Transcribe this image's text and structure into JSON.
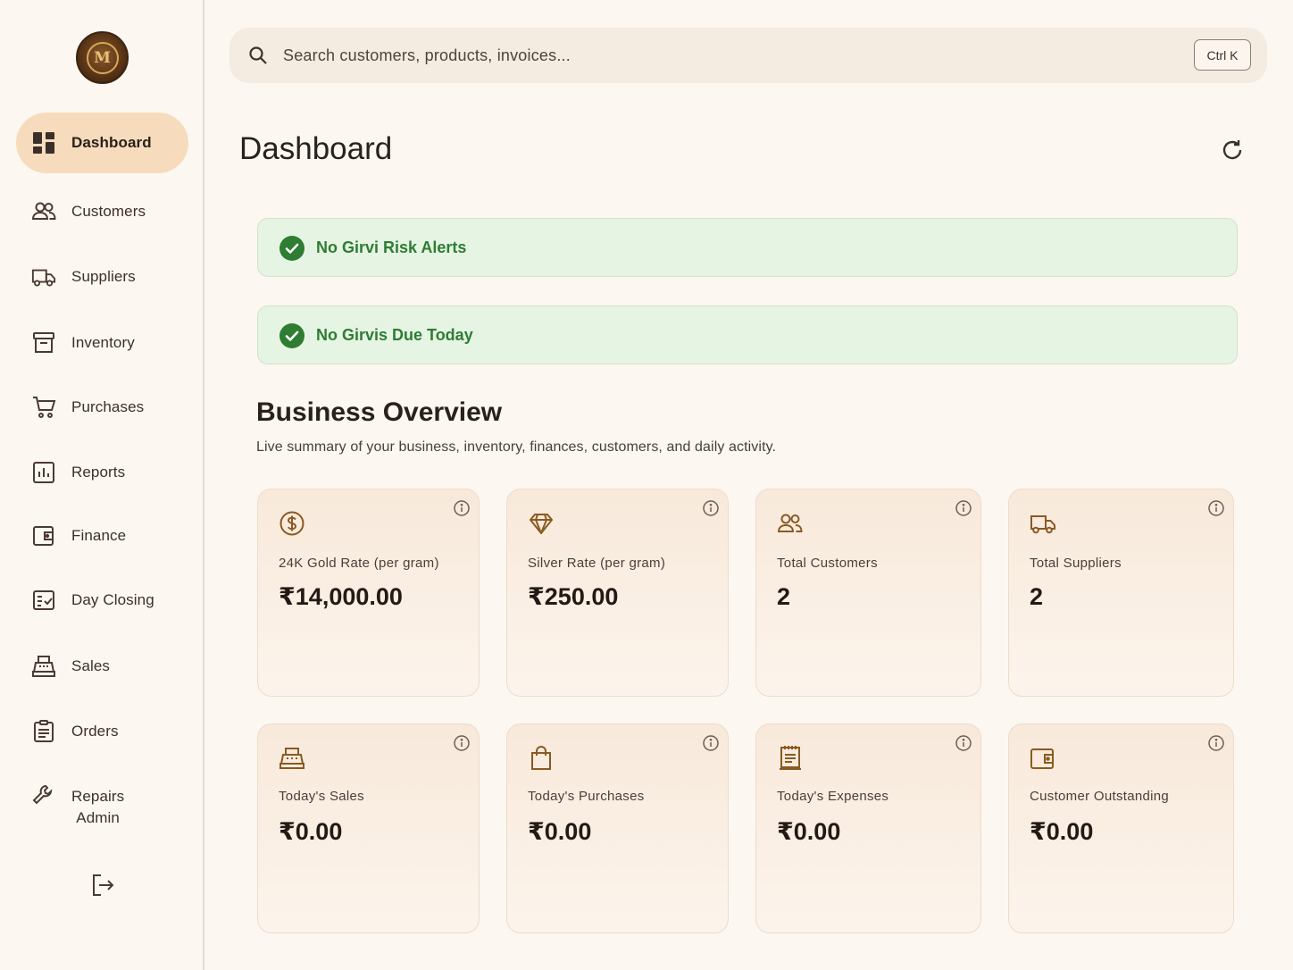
{
  "brand": {
    "logo_letter": "M"
  },
  "sidebar": {
    "items": [
      {
        "label": "Dashboard",
        "icon": "dashboard-icon",
        "active": true
      },
      {
        "label": "Customers",
        "icon": "users-icon"
      },
      {
        "label": "Suppliers",
        "icon": "truck-icon"
      },
      {
        "label": "Inventory",
        "icon": "archive-box-icon"
      },
      {
        "label": "Purchases",
        "icon": "cart-icon"
      },
      {
        "label": "Reports",
        "icon": "bar-chart-icon"
      },
      {
        "label": "Finance",
        "icon": "wallet-icon"
      },
      {
        "label": "Day Closing",
        "icon": "checklist-icon"
      },
      {
        "label": "Sales",
        "icon": "cash-register-icon"
      },
      {
        "label": "Orders",
        "icon": "clipboard-icon"
      },
      {
        "label": "Repairs Admin",
        "label_line1": "Repairs",
        "label_line2": "Admin",
        "icon": "wrench-icon"
      }
    ],
    "logout_icon": "logout-icon"
  },
  "search": {
    "placeholder": "Search customers, products, invoices...",
    "value": "",
    "shortcut": "Ctrl K"
  },
  "header": {
    "title": "Dashboard",
    "refresh_icon": "refresh-icon"
  },
  "alerts": [
    {
      "text": "No Girvi Risk Alerts",
      "status": "ok",
      "color": "#2e7d32"
    },
    {
      "text": "No Girvis Due Today",
      "status": "ok",
      "color": "#2e7d32"
    }
  ],
  "overview": {
    "title": "Business Overview",
    "subtitle": "Live summary of your business, inventory, finances, customers, and daily activity.",
    "cards": [
      {
        "label": "24K Gold Rate (per gram)",
        "value": "₹14,000.00",
        "icon": "dollar-coin-icon"
      },
      {
        "label": "Silver Rate (per gram)",
        "value": "₹250.00",
        "icon": "diamond-icon"
      },
      {
        "label": "Total Customers",
        "value": "2",
        "icon": "users-icon"
      },
      {
        "label": "Total Suppliers",
        "value": "2",
        "icon": "truck-icon"
      },
      {
        "label": "Today's Sales",
        "value": "₹0.00",
        "icon": "cash-register-icon"
      },
      {
        "label": "Today's Purchases",
        "value": "₹0.00",
        "icon": "shopping-bag-icon"
      },
      {
        "label": "Today's Expenses",
        "value": "₹0.00",
        "icon": "receipt-icon"
      },
      {
        "label": "Customer Outstanding",
        "value": "₹0.00",
        "icon": "wallet-icon"
      }
    ]
  },
  "colors": {
    "accent": "#f6dcbc",
    "icon_brown": "#8a5a22",
    "success": "#2e7d32",
    "background": "#fcf7f1"
  }
}
